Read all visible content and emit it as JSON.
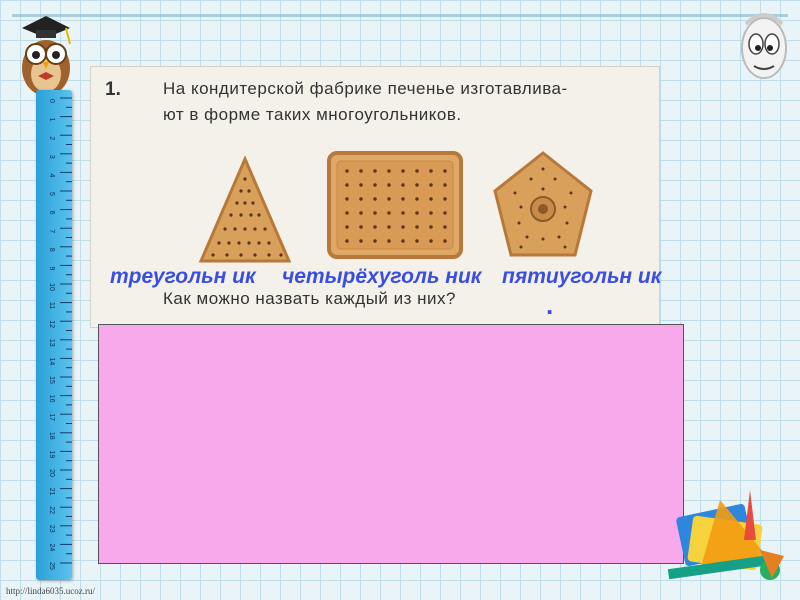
{
  "task": {
    "number": "1.",
    "line1": "На кондитерской фабрике печенье изготавлива-",
    "line2": "ют в форме таких многоугольников.",
    "question": "Как можно назвать каждый из них?"
  },
  "answers": [
    {
      "text": "треугольн ик"
    },
    {
      "text": "четырёхуголь ник"
    },
    {
      "text": "пятиугольн ик"
    }
  ],
  "period": ".",
  "ruler": {
    "numbers": [
      "0",
      "1",
      "2",
      "3",
      "4",
      "5",
      "6",
      "7",
      "8",
      "9",
      "10",
      "11",
      "12",
      "13",
      "14",
      "15",
      "16",
      "17",
      "18",
      "19",
      "20",
      "21",
      "22",
      "23",
      "24",
      "25"
    ]
  },
  "footer": {
    "credit": "http://linda6035.ucoz.ru/"
  }
}
